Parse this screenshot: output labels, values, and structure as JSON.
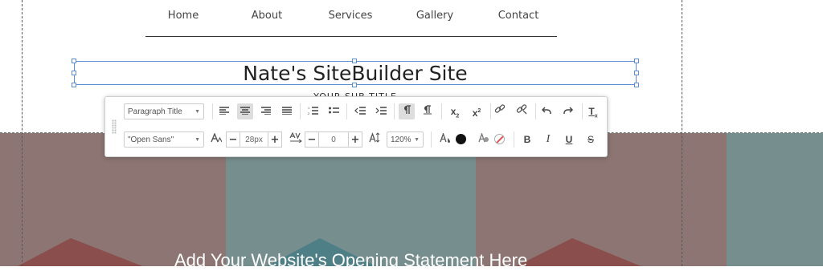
{
  "nav": {
    "items": [
      {
        "label": "Home"
      },
      {
        "label": "About"
      },
      {
        "label": "Services"
      },
      {
        "label": "Gallery"
      },
      {
        "label": "Contact"
      }
    ]
  },
  "header": {
    "site_title": "Nate's SiteBuilder Site",
    "subtitle": "YOUR SUB TITLE"
  },
  "hero": {
    "statement": "Add Your Website's Opening Statement Here",
    "colors": {
      "mauve": "#8c7572",
      "teal": "#778e8e",
      "dark_red": "#8a4f4c",
      "dark_teal": "#4f7f86"
    }
  },
  "toolbar": {
    "paragraph_style": "Paragraph Title",
    "font_family": "\"Open Sans\"",
    "font_size": "28px",
    "letter_spacing": "0",
    "line_height": "120%",
    "icons": {
      "align_left": "align-left-icon",
      "align_center": "align-center-icon",
      "align_right": "align-right-icon",
      "align_justify": "align-justify-icon",
      "ordered_list": "ordered-list-icon",
      "unordered_list": "unordered-list-icon",
      "outdent": "outdent-icon",
      "indent": "indent-icon",
      "paragraph": "paragraph-icon",
      "subscript": "subscript-icon",
      "superscript": "superscript-icon",
      "link": "link-icon",
      "unlink": "unlink-icon",
      "undo": "undo-icon",
      "redo": "redo-icon",
      "clear_format": "clear-format-icon"
    },
    "glyphs": {
      "subscript_base": "x",
      "subscript_mark": "2",
      "superscript_base": "x",
      "superscript_mark": "2",
      "clear_base": "T",
      "clear_mark": "x",
      "bold": "B",
      "italic": "I",
      "underline": "U",
      "strike": "S",
      "plus": "+",
      "minus": "−"
    },
    "text_color": "#111111"
  }
}
